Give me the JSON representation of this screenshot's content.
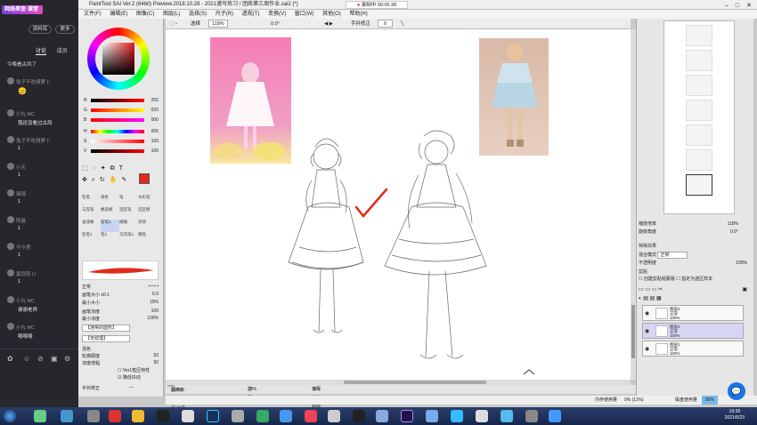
{
  "chat": {
    "brand": "网络美宣·课堂",
    "btn_material": "资料库",
    "btn_more": "更多",
    "tabs": [
      "讨论",
      "成员"
    ],
    "intro": "今晚看古风了",
    "messages": [
      {
        "user": "兔子不吃胡萝卜",
        "text": "😊"
      },
      {
        "user": "小丸 MC",
        "text": "我还没看过古风"
      },
      {
        "user": "兔子不吃胡萝卜",
        "text": "1"
      },
      {
        "user": "小天",
        "text": "1"
      },
      {
        "user": "琦琦",
        "text": "1"
      },
      {
        "user": "阿晨",
        "text": "1"
      },
      {
        "user": "今今君",
        "text": "1"
      },
      {
        "user": "夏目阳 U",
        "text": "1"
      },
      {
        "user": "小丸 MC",
        "text": "谢谢老师"
      },
      {
        "user": "小丸 MC",
        "text": "嘻嘻嘻"
      }
    ],
    "toolbar_icons": [
      "flower-icon",
      "smile-icon",
      "ban-icon",
      "image-icon",
      "settings-icon"
    ]
  },
  "window": {
    "title": "PaintTool SAI Ver.2 (64bit) Preview.2018.10.28 - 2021速写练习 / 团练第三周作业.sai2 (*)",
    "recording": "录制中 00:06:38",
    "menu": [
      "文件(F)",
      "编辑(E)",
      "图像(C)",
      "图层(L)",
      "选择(S)",
      "尺子(R)",
      "透视(T)",
      "变换(V)",
      "窗口(W)",
      "其他(O)",
      "帮助(H)"
    ]
  },
  "color": {
    "sliders": [
      {
        "label": "R",
        "value": "255"
      },
      {
        "label": "G",
        "value": "020"
      },
      {
        "label": "B",
        "value": "000"
      },
      {
        "label": "H",
        "value": "005"
      },
      {
        "label": "S",
        "value": "100"
      },
      {
        "label": "V",
        "value": "100"
      }
    ],
    "foreground": "#e02a1a"
  },
  "tools": {
    "grid": [
      "铅笔",
      "喷枪",
      "笔",
      "水彩笔",
      "马克笔",
      "橡皮擦",
      "选区笔",
      "选区擦",
      "油漆桶",
      "模糊",
      "铅笔2",
      "涂改",
      "钢笔",
      "铅笔1",
      "笔2",
      "马克笔2"
    ],
    "selected": "铅笔2",
    "mode": "正常",
    "props": [
      {
        "label": "画笔大小",
        "value": "x0.1",
        "extra": "6.0"
      },
      {
        "label": "最小大小",
        "value": "",
        "extra": "15%"
      },
      {
        "label": "画笔浓度",
        "value": "",
        "extra": "100"
      },
      {
        "label": "最小浓度",
        "value": "",
        "extra": "100%"
      }
    ],
    "shape_select": "【通常的圆形】",
    "texture_select": "【无纹理】",
    "mixing_label": "混色",
    "stabilizer_props": [
      {
        "label": "轮廓硬度",
        "value": "53"
      },
      {
        "label": "浓度增幅",
        "value": "50"
      }
    ],
    "checks": [
      "Ver1笔压特性",
      "降低抖动"
    ],
    "hand_correction_label": "手抖修正",
    "hand_correction_value": "—"
  },
  "canvas_toolbar": {
    "select_label": "选择",
    "zoom": "118%",
    "angle": "0.0°",
    "stabilizer_label": "手抖修正",
    "stabilizer_value": "6"
  },
  "doc_tabs": [
    {
      "name": "团练第三周作业.sai2",
      "zoom": "118%"
    },
    {
      "name": "古风.sai2",
      "zoom": "29%"
    },
    {
      "name": "速写课追踪貌巴.jpg",
      "zoom": "75%"
    }
  ],
  "status": {
    "memory": "内存使用量",
    "memory_value": "9% (11%)",
    "disk": "磁盘使用量",
    "disk_value": "85%"
  },
  "right": {
    "nav_zoom": "118%",
    "nav_angle": "0.0°",
    "nav_zoom_label": "缩放倍率",
    "nav_angle_label": "旋转角度",
    "effects_label": "特殊效果",
    "blend_label": "混合模式",
    "blend_value": "正常",
    "opacity_label": "不透明度",
    "opacity_value": "100%",
    "clip_label": "剪贴",
    "check1": "创建剪贴组蒙版",
    "check2": "指定为选区样本",
    "layers": [
      {
        "name": "图层3",
        "mode": "正常",
        "opacity": "100%"
      },
      {
        "name": "图层2",
        "mode": "正常",
        "opacity": "100%"
      },
      {
        "name": "图层1",
        "mode": "正常",
        "opacity": "100%"
      }
    ]
  },
  "taskbar": {
    "time": "19:38",
    "date": "2021/6/23"
  }
}
